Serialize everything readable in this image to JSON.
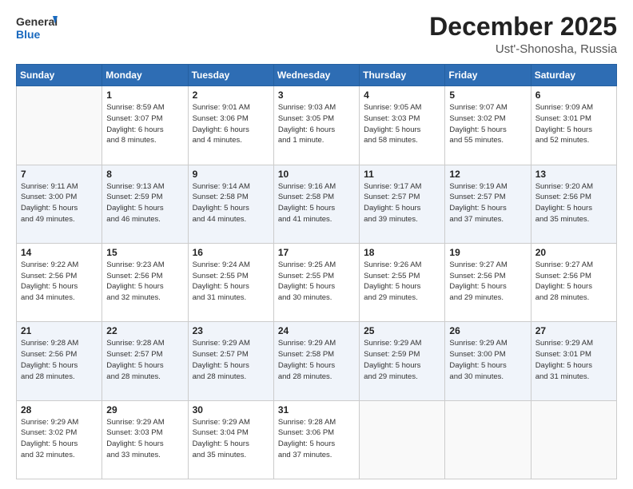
{
  "logo": {
    "general": "General",
    "blue": "Blue"
  },
  "title": {
    "month_year": "December 2025",
    "location": "Ust'-Shonosha, Russia"
  },
  "days_of_week": [
    "Sunday",
    "Monday",
    "Tuesday",
    "Wednesday",
    "Thursday",
    "Friday",
    "Saturday"
  ],
  "weeks": [
    [
      {
        "day": "",
        "info": ""
      },
      {
        "day": "1",
        "info": "Sunrise: 8:59 AM\nSunset: 3:07 PM\nDaylight: 6 hours\nand 8 minutes."
      },
      {
        "day": "2",
        "info": "Sunrise: 9:01 AM\nSunset: 3:06 PM\nDaylight: 6 hours\nand 4 minutes."
      },
      {
        "day": "3",
        "info": "Sunrise: 9:03 AM\nSunset: 3:05 PM\nDaylight: 6 hours\nand 1 minute."
      },
      {
        "day": "4",
        "info": "Sunrise: 9:05 AM\nSunset: 3:03 PM\nDaylight: 5 hours\nand 58 minutes."
      },
      {
        "day": "5",
        "info": "Sunrise: 9:07 AM\nSunset: 3:02 PM\nDaylight: 5 hours\nand 55 minutes."
      },
      {
        "day": "6",
        "info": "Sunrise: 9:09 AM\nSunset: 3:01 PM\nDaylight: 5 hours\nand 52 minutes."
      }
    ],
    [
      {
        "day": "7",
        "info": "Sunrise: 9:11 AM\nSunset: 3:00 PM\nDaylight: 5 hours\nand 49 minutes."
      },
      {
        "day": "8",
        "info": "Sunrise: 9:13 AM\nSunset: 2:59 PM\nDaylight: 5 hours\nand 46 minutes."
      },
      {
        "day": "9",
        "info": "Sunrise: 9:14 AM\nSunset: 2:58 PM\nDaylight: 5 hours\nand 44 minutes."
      },
      {
        "day": "10",
        "info": "Sunrise: 9:16 AM\nSunset: 2:58 PM\nDaylight: 5 hours\nand 41 minutes."
      },
      {
        "day": "11",
        "info": "Sunrise: 9:17 AM\nSunset: 2:57 PM\nDaylight: 5 hours\nand 39 minutes."
      },
      {
        "day": "12",
        "info": "Sunrise: 9:19 AM\nSunset: 2:57 PM\nDaylight: 5 hours\nand 37 minutes."
      },
      {
        "day": "13",
        "info": "Sunrise: 9:20 AM\nSunset: 2:56 PM\nDaylight: 5 hours\nand 35 minutes."
      }
    ],
    [
      {
        "day": "14",
        "info": "Sunrise: 9:22 AM\nSunset: 2:56 PM\nDaylight: 5 hours\nand 34 minutes."
      },
      {
        "day": "15",
        "info": "Sunrise: 9:23 AM\nSunset: 2:56 PM\nDaylight: 5 hours\nand 32 minutes."
      },
      {
        "day": "16",
        "info": "Sunrise: 9:24 AM\nSunset: 2:55 PM\nDaylight: 5 hours\nand 31 minutes."
      },
      {
        "day": "17",
        "info": "Sunrise: 9:25 AM\nSunset: 2:55 PM\nDaylight: 5 hours\nand 30 minutes."
      },
      {
        "day": "18",
        "info": "Sunrise: 9:26 AM\nSunset: 2:55 PM\nDaylight: 5 hours\nand 29 minutes."
      },
      {
        "day": "19",
        "info": "Sunrise: 9:27 AM\nSunset: 2:56 PM\nDaylight: 5 hours\nand 29 minutes."
      },
      {
        "day": "20",
        "info": "Sunrise: 9:27 AM\nSunset: 2:56 PM\nDaylight: 5 hours\nand 28 minutes."
      }
    ],
    [
      {
        "day": "21",
        "info": "Sunrise: 9:28 AM\nSunset: 2:56 PM\nDaylight: 5 hours\nand 28 minutes."
      },
      {
        "day": "22",
        "info": "Sunrise: 9:28 AM\nSunset: 2:57 PM\nDaylight: 5 hours\nand 28 minutes."
      },
      {
        "day": "23",
        "info": "Sunrise: 9:29 AM\nSunset: 2:57 PM\nDaylight: 5 hours\nand 28 minutes."
      },
      {
        "day": "24",
        "info": "Sunrise: 9:29 AM\nSunset: 2:58 PM\nDaylight: 5 hours\nand 28 minutes."
      },
      {
        "day": "25",
        "info": "Sunrise: 9:29 AM\nSunset: 2:59 PM\nDaylight: 5 hours\nand 29 minutes."
      },
      {
        "day": "26",
        "info": "Sunrise: 9:29 AM\nSunset: 3:00 PM\nDaylight: 5 hours\nand 30 minutes."
      },
      {
        "day": "27",
        "info": "Sunrise: 9:29 AM\nSunset: 3:01 PM\nDaylight: 5 hours\nand 31 minutes."
      }
    ],
    [
      {
        "day": "28",
        "info": "Sunrise: 9:29 AM\nSunset: 3:02 PM\nDaylight: 5 hours\nand 32 minutes."
      },
      {
        "day": "29",
        "info": "Sunrise: 9:29 AM\nSunset: 3:03 PM\nDaylight: 5 hours\nand 33 minutes."
      },
      {
        "day": "30",
        "info": "Sunrise: 9:29 AM\nSunset: 3:04 PM\nDaylight: 5 hours\nand 35 minutes."
      },
      {
        "day": "31",
        "info": "Sunrise: 9:28 AM\nSunset: 3:06 PM\nDaylight: 5 hours\nand 37 minutes."
      },
      {
        "day": "",
        "info": ""
      },
      {
        "day": "",
        "info": ""
      },
      {
        "day": "",
        "info": ""
      }
    ]
  ]
}
